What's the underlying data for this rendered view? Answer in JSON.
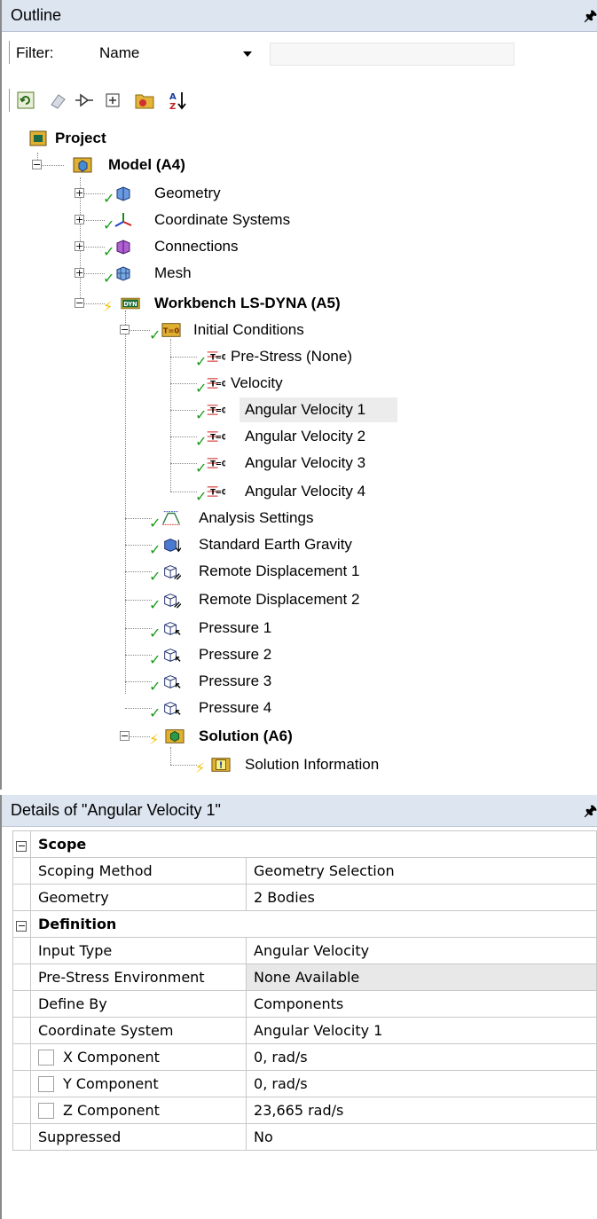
{
  "outline": {
    "title": "Outline",
    "filter_label": "Filter:",
    "filter_value": "Name",
    "filter_text": "",
    "toolbar_icons": [
      "refresh-icon",
      "eraser-icon",
      "expand-tree-icon",
      "plus-box-icon",
      "folder-icon",
      "sort-az-icon"
    ],
    "tree": {
      "project": "Project",
      "model": "Model (A4)",
      "geometry": "Geometry",
      "coordinate_systems": "Coordinate Systems",
      "connections": "Connections",
      "mesh": "Mesh",
      "workbench": "Workbench LS-DYNA (A5)",
      "initial_conditions": "Initial Conditions",
      "pre_stress": "Pre-Stress (None)",
      "velocity": "Velocity",
      "angular_velocity_1": "Angular Velocity 1",
      "angular_velocity_2": "Angular Velocity 2",
      "angular_velocity_3": "Angular Velocity 3",
      "angular_velocity_4": "Angular Velocity 4",
      "analysis_settings": "Analysis Settings",
      "standard_earth_gravity": "Standard Earth Gravity",
      "remote_displacement_1": "Remote Displacement 1",
      "remote_displacement_2": "Remote Displacement 2",
      "pressure_1": "Pressure 1",
      "pressure_2": "Pressure 2",
      "pressure_3": "Pressure 3",
      "pressure_4": "Pressure 4",
      "solution": "Solution (A6)",
      "solution_information": "Solution Information"
    },
    "icon_text": {
      "dyn": "DYN",
      "ic": "T=0",
      "tzero": "T=0"
    }
  },
  "details": {
    "title": "Details of \"Angular Velocity 1\"",
    "groups": {
      "scope": "Scope",
      "definition": "Definition"
    },
    "rows": {
      "scoping_method": {
        "label": "Scoping Method",
        "value": "Geometry Selection"
      },
      "geometry": {
        "label": "Geometry",
        "value": "2 Bodies"
      },
      "input_type": {
        "label": "Input Type",
        "value": "Angular Velocity"
      },
      "pre_stress_env": {
        "label": "Pre-Stress Environment",
        "value": "None Available"
      },
      "define_by": {
        "label": "Define By",
        "value": "Components"
      },
      "coordinate_system": {
        "label": "Coordinate System",
        "value": "Angular Velocity 1"
      },
      "x_component": {
        "label": "X Component",
        "value": "0, rad/s"
      },
      "y_component": {
        "label": "Y Component",
        "value": "0, rad/s"
      },
      "z_component": {
        "label": "Z Component",
        "value": "23,665 rad/s"
      },
      "suppressed": {
        "label": "Suppressed",
        "value": "No"
      }
    }
  },
  "colors": {
    "header_bg": "#dde5f0",
    "check_green": "#1a9a1a",
    "bolt_yellow": "#f2c000"
  }
}
